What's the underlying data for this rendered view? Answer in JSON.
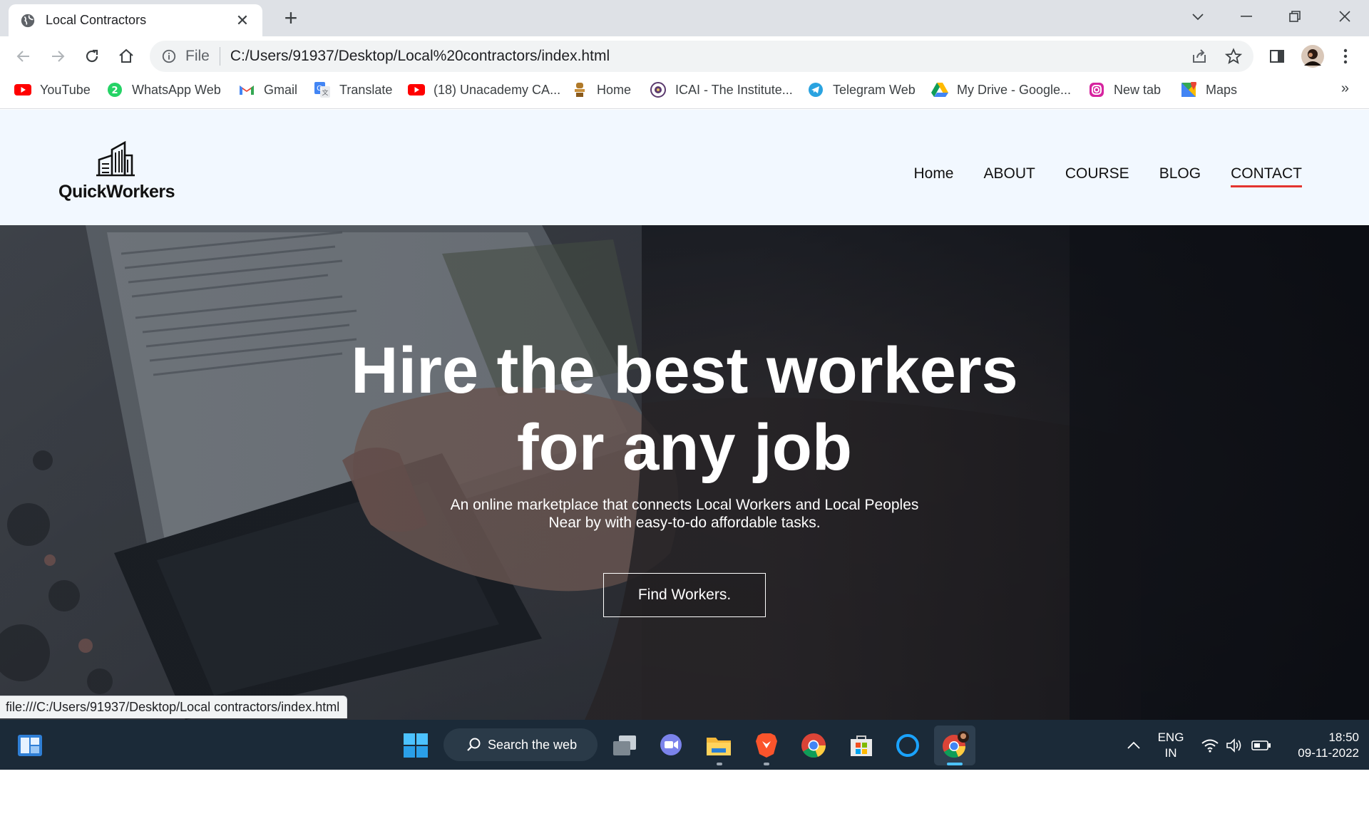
{
  "browser": {
    "tab": {
      "title": "Local Contractors"
    },
    "address": {
      "scheme_label": "File",
      "url": "C:/Users/91937/Desktop/Local%20contractors/index.html"
    },
    "bookmarks": [
      {
        "label": "YouTube",
        "icon": "youtube-icon"
      },
      {
        "label": "WhatsApp Web",
        "icon": "whatsapp-icon"
      },
      {
        "label": "Gmail",
        "icon": "gmail-icon"
      },
      {
        "label": "Translate",
        "icon": "translate-icon"
      },
      {
        "label": "(18) Unacademy CA...",
        "icon": "youtube-icon"
      },
      {
        "label": "Home",
        "icon": "emblem-icon"
      },
      {
        "label": "ICAI - The Institute...",
        "icon": "icai-icon"
      },
      {
        "label": "Telegram Web",
        "icon": "telegram-icon"
      },
      {
        "label": "My Drive - Google...",
        "icon": "drive-icon"
      },
      {
        "label": "New tab",
        "icon": "instagram-icon"
      },
      {
        "label": "Maps",
        "icon": "maps-icon"
      }
    ],
    "status_url": "file:///C:/Users/91937/Desktop/Local contractors/index.html"
  },
  "site": {
    "logo_text": "QuickWorkers",
    "nav": [
      {
        "label": "Home",
        "active": false
      },
      {
        "label": "ABOUT",
        "active": false
      },
      {
        "label": "COURSE",
        "active": false
      },
      {
        "label": "BLOG",
        "active": false
      },
      {
        "label": "CONTACT",
        "active": true
      }
    ],
    "hero": {
      "title_line1": "Hire the best workers",
      "title_line2": "for any job",
      "subtitle_line1": "An online marketplace that connects Local Workers and Local Peoples",
      "subtitle_line2": "Near by with easy-to-do affordable tasks.",
      "button": "Find Workers."
    },
    "colors": {
      "header_bg": "#f2f8ff",
      "active_underline": "#e3342f"
    }
  },
  "taskbar": {
    "search_label": "Search the web",
    "language_line1": "ENG",
    "language_line2": "IN",
    "time": "18:50",
    "date": "09-11-2022"
  }
}
